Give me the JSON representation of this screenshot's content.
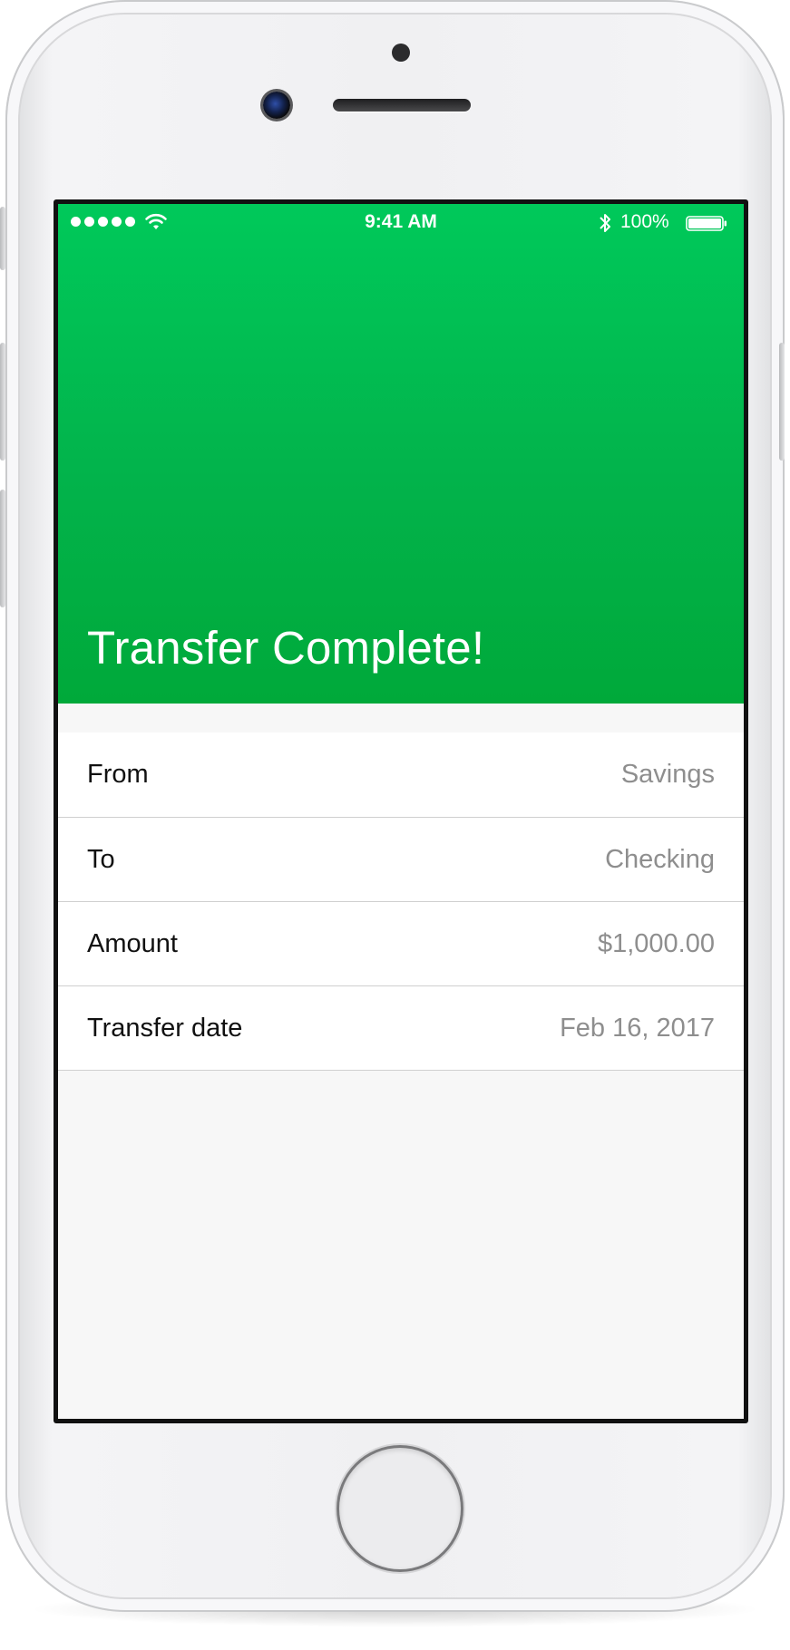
{
  "status_bar": {
    "time": "9:41 AM",
    "battery_percent": "100%",
    "signal_bars": 5,
    "icons": [
      "signal-dots-icon",
      "wifi-icon",
      "bluetooth-icon",
      "battery-icon"
    ]
  },
  "header": {
    "title": "Transfer Complete!",
    "background_color": "#00b84a"
  },
  "details": {
    "rows": [
      {
        "label": "From",
        "value": "Savings"
      },
      {
        "label": "To",
        "value": "Checking"
      },
      {
        "label": "Amount",
        "value": "$1,000.00"
      },
      {
        "label": "Transfer date",
        "value": "Feb 16, 2017"
      }
    ]
  },
  "colors": {
    "accent": "#00b84a",
    "label_text": "#111111",
    "value_text": "#8e8e8e",
    "background": "#f7f7f7"
  },
  "device": {
    "icons": [
      "front-camera-icon",
      "speaker-icon",
      "home-button-icon"
    ]
  }
}
